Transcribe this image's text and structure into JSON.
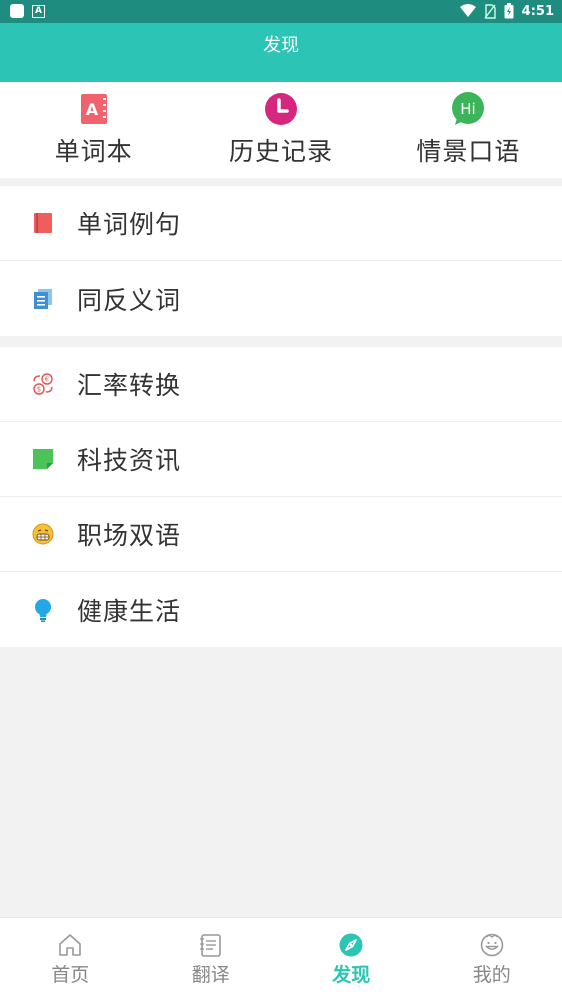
{
  "status_bar": {
    "time": "4:51"
  },
  "app_bar": {
    "title": "发现"
  },
  "shortcuts": [
    {
      "label": "单词本",
      "icon": "notebook-icon",
      "color": "#f0636e"
    },
    {
      "label": "历史记录",
      "icon": "clock-icon",
      "color": "#d6277f"
    },
    {
      "label": "情景口语",
      "icon": "hi-bubble-icon",
      "color": "#3cb45a",
      "icon_text": "Hi"
    }
  ],
  "group1": [
    {
      "label": "单词例句",
      "icon": "red-book-icon",
      "color": "#ef5d5d"
    },
    {
      "label": "同反义词",
      "icon": "documents-icon",
      "color": "#3d8fd6"
    }
  ],
  "group2": [
    {
      "label": "汇率转换",
      "icon": "currency-exchange-icon",
      "color": "#e85a5a"
    },
    {
      "label": "科技资讯",
      "icon": "green-note-icon",
      "color": "#4cc25a"
    },
    {
      "label": "职场双语",
      "icon": "grin-face-icon",
      "color": "#f0a820"
    },
    {
      "label": "健康生活",
      "icon": "lightbulb-icon",
      "color": "#22a7e8"
    }
  ],
  "bottom_nav": [
    {
      "label": "首页",
      "icon": "home-icon",
      "active": false
    },
    {
      "label": "翻译",
      "icon": "notepad-icon",
      "active": false
    },
    {
      "label": "发现",
      "icon": "compass-icon",
      "active": true
    },
    {
      "label": "我的",
      "icon": "smiley-icon",
      "active": false
    }
  ],
  "colors": {
    "primary": "#2cc4b4",
    "status_bar": "#1e8c7e",
    "inactive": "#888888"
  }
}
